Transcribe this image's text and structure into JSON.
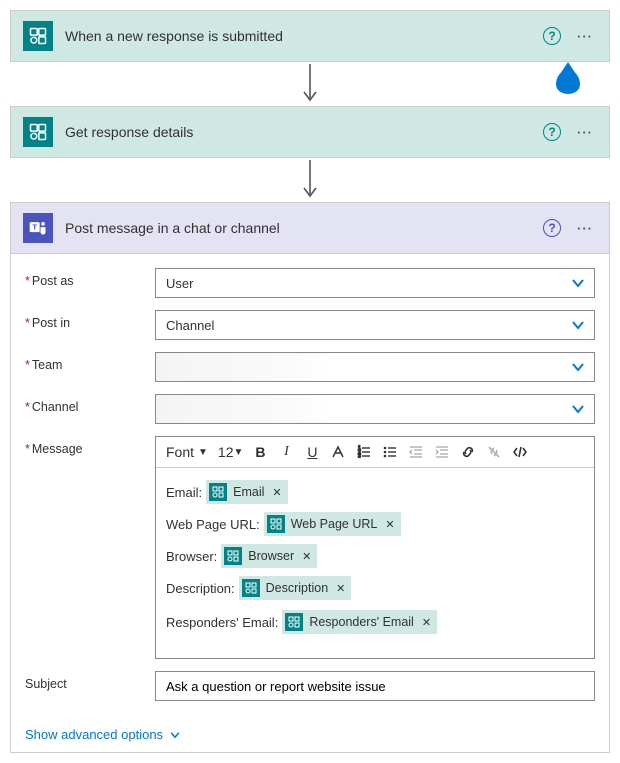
{
  "actions": {
    "trigger": {
      "title": "When a new response is submitted"
    },
    "getDetails": {
      "title": "Get response details"
    },
    "postMessage": {
      "title": "Post message in a chat or channel"
    }
  },
  "form": {
    "postAs": {
      "label": "Post as",
      "value": "User"
    },
    "postIn": {
      "label": "Post in",
      "value": "Channel"
    },
    "team": {
      "label": "Team",
      "value": ""
    },
    "channel": {
      "label": "Channel",
      "value": ""
    },
    "message": {
      "label": "Message"
    },
    "subject": {
      "label": "Subject",
      "value": "Ask a question or report website issue"
    }
  },
  "toolbar": {
    "font": "Font",
    "size": "12"
  },
  "editor": {
    "lines": {
      "email": {
        "prefix": "Email:",
        "token": "Email"
      },
      "url": {
        "prefix": "Web Page URL:",
        "token": "Web Page URL"
      },
      "browser": {
        "prefix": "Browser:",
        "token": "Browser"
      },
      "desc": {
        "prefix": "Description:",
        "token": "Description"
      },
      "responder": {
        "prefix": "Responders' Email:",
        "token": "Responders' Email"
      }
    }
  },
  "advanced": "Show advanced options"
}
